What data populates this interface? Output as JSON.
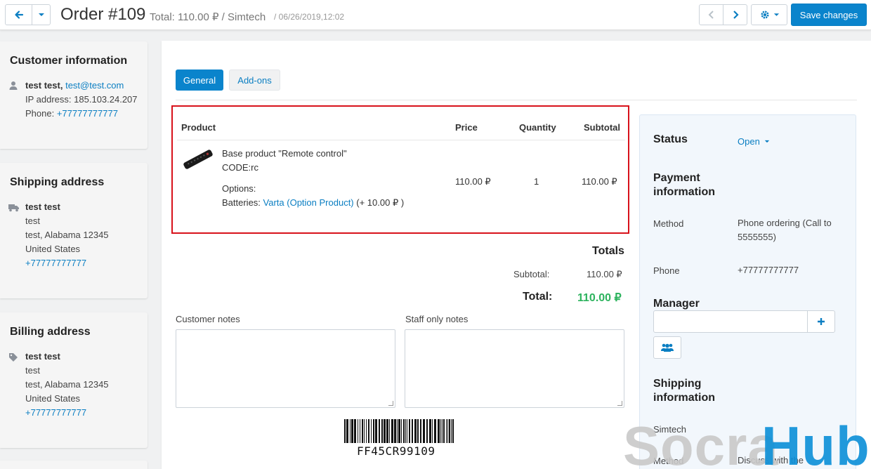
{
  "header": {
    "title": "Order #109",
    "summary": "Total: 110.00 ₽ / Simtech",
    "date": "/ 06/26/2019,12:02",
    "save_label": "Save changes"
  },
  "customer": {
    "heading": "Customer information",
    "name": "test test,",
    "email": "test@test.com",
    "ip_label": "IP address:",
    "ip": "185.103.24.207",
    "phone_label": "Phone:",
    "phone": "+77777777777"
  },
  "shipping_address": {
    "heading": "Shipping address",
    "name": "test test",
    "line1": "test",
    "line2": "test, Alabama 12345",
    "country": "United States",
    "phone": "+77777777777"
  },
  "billing_address": {
    "heading": "Billing address",
    "name": "test test",
    "line1": "test",
    "line2": "test, Alabama 12345",
    "country": "United States",
    "phone": "+77777777777"
  },
  "tabs": [
    {
      "label": "General",
      "active": true
    },
    {
      "label": "Add-ons",
      "active": false
    }
  ],
  "products_table": {
    "columns": [
      "Product",
      "Price",
      "Quantity",
      "Subtotal"
    ],
    "rows": [
      {
        "name": "Base product \"Remote control\"",
        "code": "CODE:rc",
        "options_label": "Options:",
        "option_name": "Batteries:",
        "option_value": "Varta (Option Product)",
        "option_modifier": "(+ 10.00 ₽ )",
        "price": "110.00 ₽",
        "quantity": "1",
        "subtotal": "110.00 ₽"
      }
    ]
  },
  "totals": {
    "heading": "Totals",
    "subtotal_label": "Subtotal:",
    "subtotal": "110.00 ₽",
    "total_label": "Total:",
    "total": "110.00 ₽"
  },
  "notes": {
    "customer_label": "Customer notes",
    "staff_label": "Staff only notes",
    "customer_value": "",
    "staff_value": ""
  },
  "barcode": "FF45CR99109",
  "sidebar_right": {
    "status_heading": "Status",
    "status_value": "Open",
    "payment_heading": "Payment information",
    "method_label": "Method",
    "method_value": "Phone ordering (Call to 5555555)",
    "phone_label": "Phone",
    "phone_value": "+77777777777",
    "manager_heading": "Manager",
    "shipping_heading": "Shipping information",
    "shipping_carrier": "Simtech",
    "shipping_method_label": "Method",
    "shipping_method_value": "Discuss with the"
  },
  "watermark": {
    "part1": "Socra",
    "part2": "Hub"
  },
  "colors": {
    "accent": "#0a84cc",
    "total_green": "#2db35e",
    "highlight_red": "#d8121b"
  }
}
